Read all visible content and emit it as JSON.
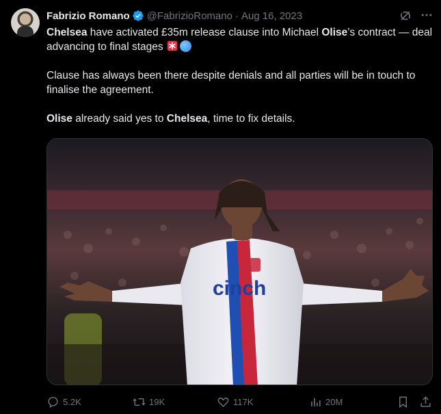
{
  "author": {
    "display_name": "Fabrizio Romano",
    "handle": "@FabrizioRomano",
    "separator": "·",
    "date": "Aug 16, 2023",
    "verified_color": "#1d9bf0"
  },
  "tweet": {
    "line1_bold1": "Chelsea",
    "line1_text1": " have activated £35m release clause into Michael ",
    "line1_bold2": "Olise",
    "line1_text2": "’s contract — deal advancing to final stages",
    "para2": "Clause has always been there despite denials and all parties will be in touch to finalise the agreement.",
    "para3_bold1": "Olise",
    "para3_text1": " already said yes to ",
    "para3_bold2": "Chelsea",
    "para3_text2": ", time to fix details."
  },
  "media": {
    "shirt_sponsor": "cinch",
    "icon": "photo-of-footballer-celebrating"
  },
  "actions": {
    "replies": "5.2K",
    "reposts": "19K",
    "likes": "117K",
    "views": "20M"
  },
  "icons": {
    "verified": "verified-badge-icon",
    "grok": "grok-icon",
    "more": "more-icon",
    "reply": "reply-icon",
    "repost": "repost-icon",
    "like": "heart-icon",
    "views": "views-icon",
    "bookmark": "bookmark-icon",
    "share": "share-icon"
  }
}
